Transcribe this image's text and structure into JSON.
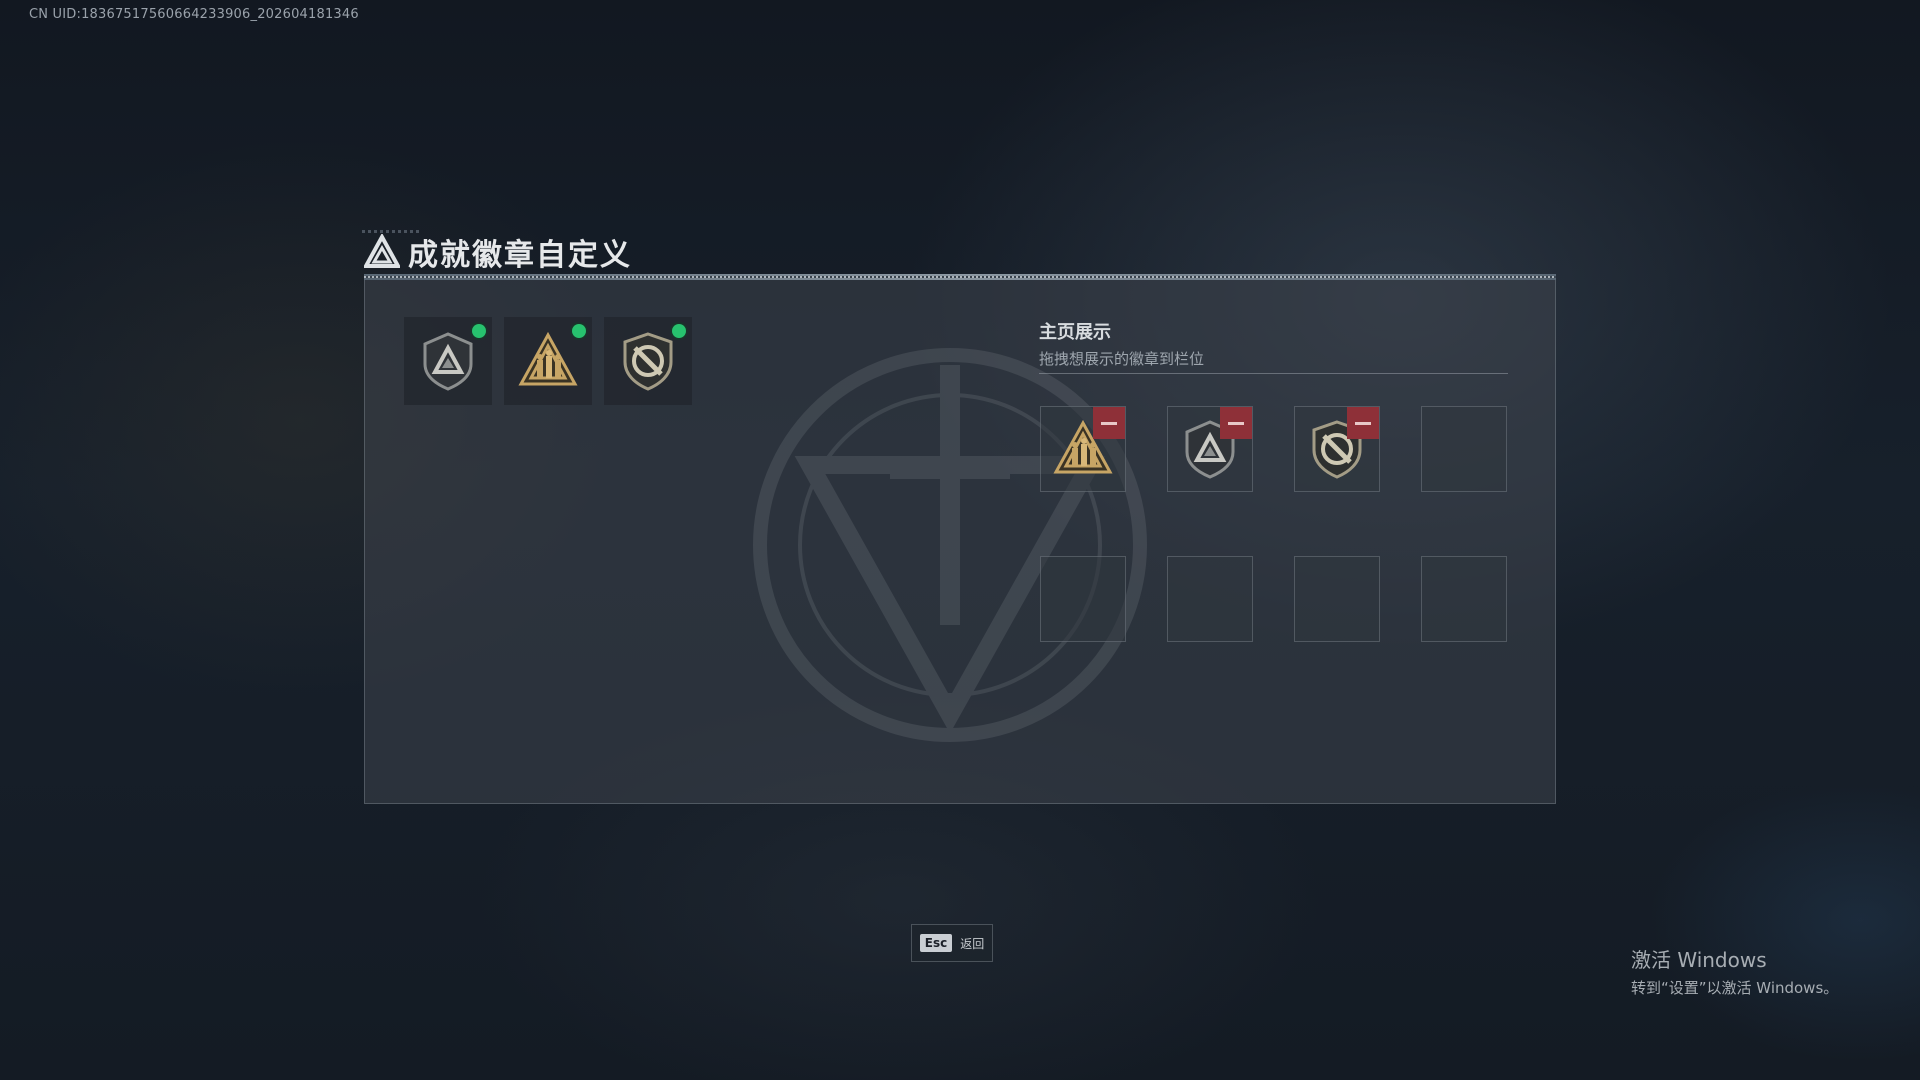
{
  "header": {
    "uid": "CN UID:1836751756066423390​6_202604181346"
  },
  "dialog": {
    "title": "成就徽章自定义"
  },
  "inventory": {
    "items": [
      {
        "icon": "triangle-shield-badge-icon",
        "equipped": true
      },
      {
        "icon": "soldiers-triangle-badge-icon",
        "equipped": true
      },
      {
        "icon": "crossed-shield-badge-icon",
        "equipped": true
      }
    ]
  },
  "showcase": {
    "title": "主页展示",
    "subtitle": "拖拽想展示的徽章到栏位",
    "slots": [
      {
        "icon": "soldiers-triangle-badge-icon"
      },
      {
        "icon": "triangle-shield-badge-icon"
      },
      {
        "icon": "crossed-shield-badge-icon"
      },
      {
        "icon": null
      },
      {
        "icon": null
      },
      {
        "icon": null
      },
      {
        "icon": null
      },
      {
        "icon": null
      }
    ]
  },
  "footer": {
    "esc_key": "Esc",
    "esc_label": "返回"
  },
  "watermark": {
    "line1": "激活 Windows",
    "line2": "转到“设置”以激活 Windows。"
  },
  "colors": {
    "accent_green": "#27c26e",
    "remove_red": "#8e3038"
  }
}
